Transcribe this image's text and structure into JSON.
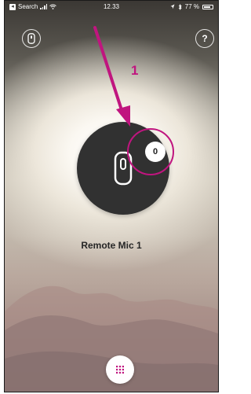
{
  "status_bar": {
    "back_label": "Search",
    "time": "12.33",
    "battery_percent": "77 %"
  },
  "header": {
    "help_label": "?"
  },
  "device": {
    "name": "Remote Mic 1",
    "badge_value": "0"
  },
  "annotation": {
    "step_number": "1",
    "color": "#c0157f"
  },
  "icons": {
    "top_left": "remote-mic-icon",
    "top_right": "help-icon",
    "center": "remote-mic-icon",
    "bottom": "grid-menu-icon"
  },
  "colors": {
    "accent": "#c0157f",
    "device_circle": "#313131"
  }
}
